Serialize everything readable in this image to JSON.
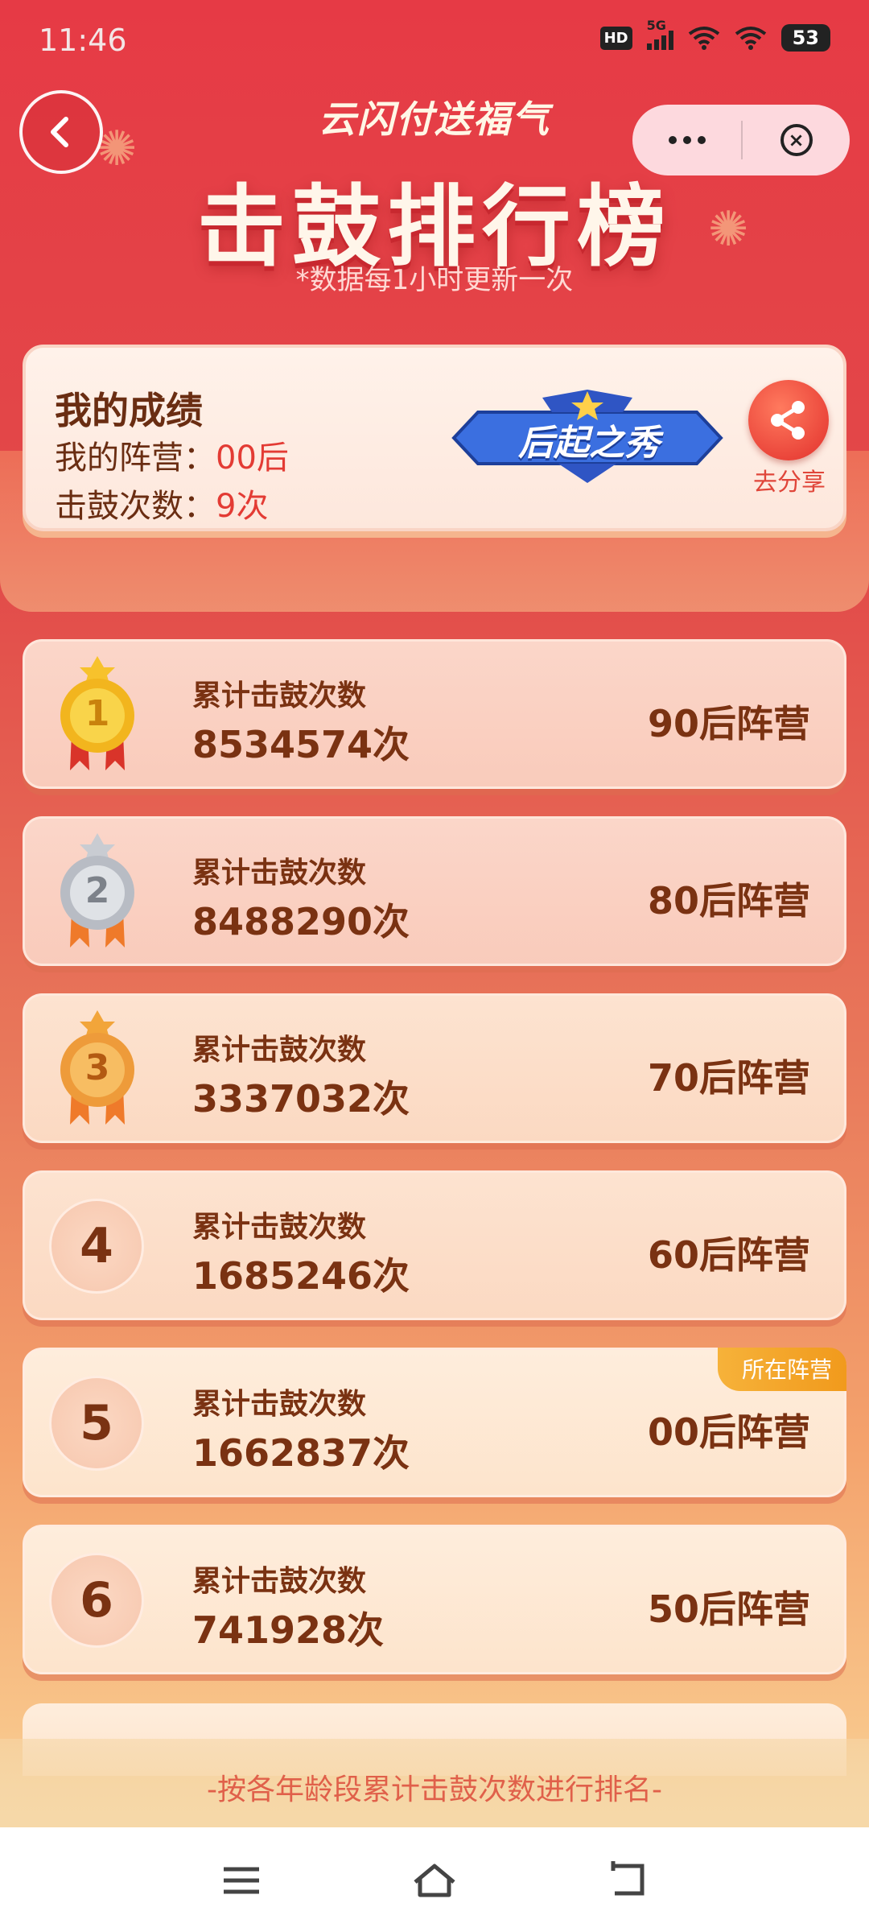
{
  "status": {
    "time": "11:46",
    "hd": "HD",
    "network": "5G",
    "battery": "53"
  },
  "header": {
    "brand": "云闪付送福气",
    "title": "击鼓排行榜",
    "subtitle": "*数据每1小时更新一次"
  },
  "my_score": {
    "title": "我的成绩",
    "camp_label": "我的阵营：",
    "camp_value": "00后",
    "count_label": "击鼓次数：",
    "count_value": "9次",
    "badge_text": "后起之秀",
    "share_label": "去分享"
  },
  "ranking": [
    {
      "rank": "1",
      "label": "累计击鼓次数",
      "count": "8534574次",
      "camp": "90后阵营",
      "medal_color": "#f2b51e"
    },
    {
      "rank": "2",
      "label": "累计击鼓次数",
      "count": "8488290次",
      "camp": "80后阵营",
      "medal_color": "#b8bcc4"
    },
    {
      "rank": "3",
      "label": "累计击鼓次数",
      "count": "3337032次",
      "camp": "70后阵营",
      "medal_color": "#ee9b3a"
    },
    {
      "rank": "4",
      "label": "累计击鼓次数",
      "count": "1685246次",
      "camp": "60后阵营"
    },
    {
      "rank": "5",
      "label": "累计击鼓次数",
      "count": "1662837次",
      "camp": "00后阵营",
      "tag": "所在阵营"
    },
    {
      "rank": "6",
      "label": "累计击鼓次数",
      "count": "741928次",
      "camp": "50后阵营"
    }
  ],
  "footer": {
    "note": "-按各年龄段累计击鼓次数进行排名-"
  },
  "icons": {
    "back": "back-arrow-icon",
    "more": "more-dots-icon",
    "close": "close-circle-icon",
    "share": "share-icon",
    "nav_menu": "menu-icon",
    "nav_home": "home-icon",
    "nav_back": "back-icon"
  },
  "colors": {
    "accent_red": "#e33b34",
    "text_brown": "#7a3212",
    "tag_orange": "#f2a52a"
  }
}
